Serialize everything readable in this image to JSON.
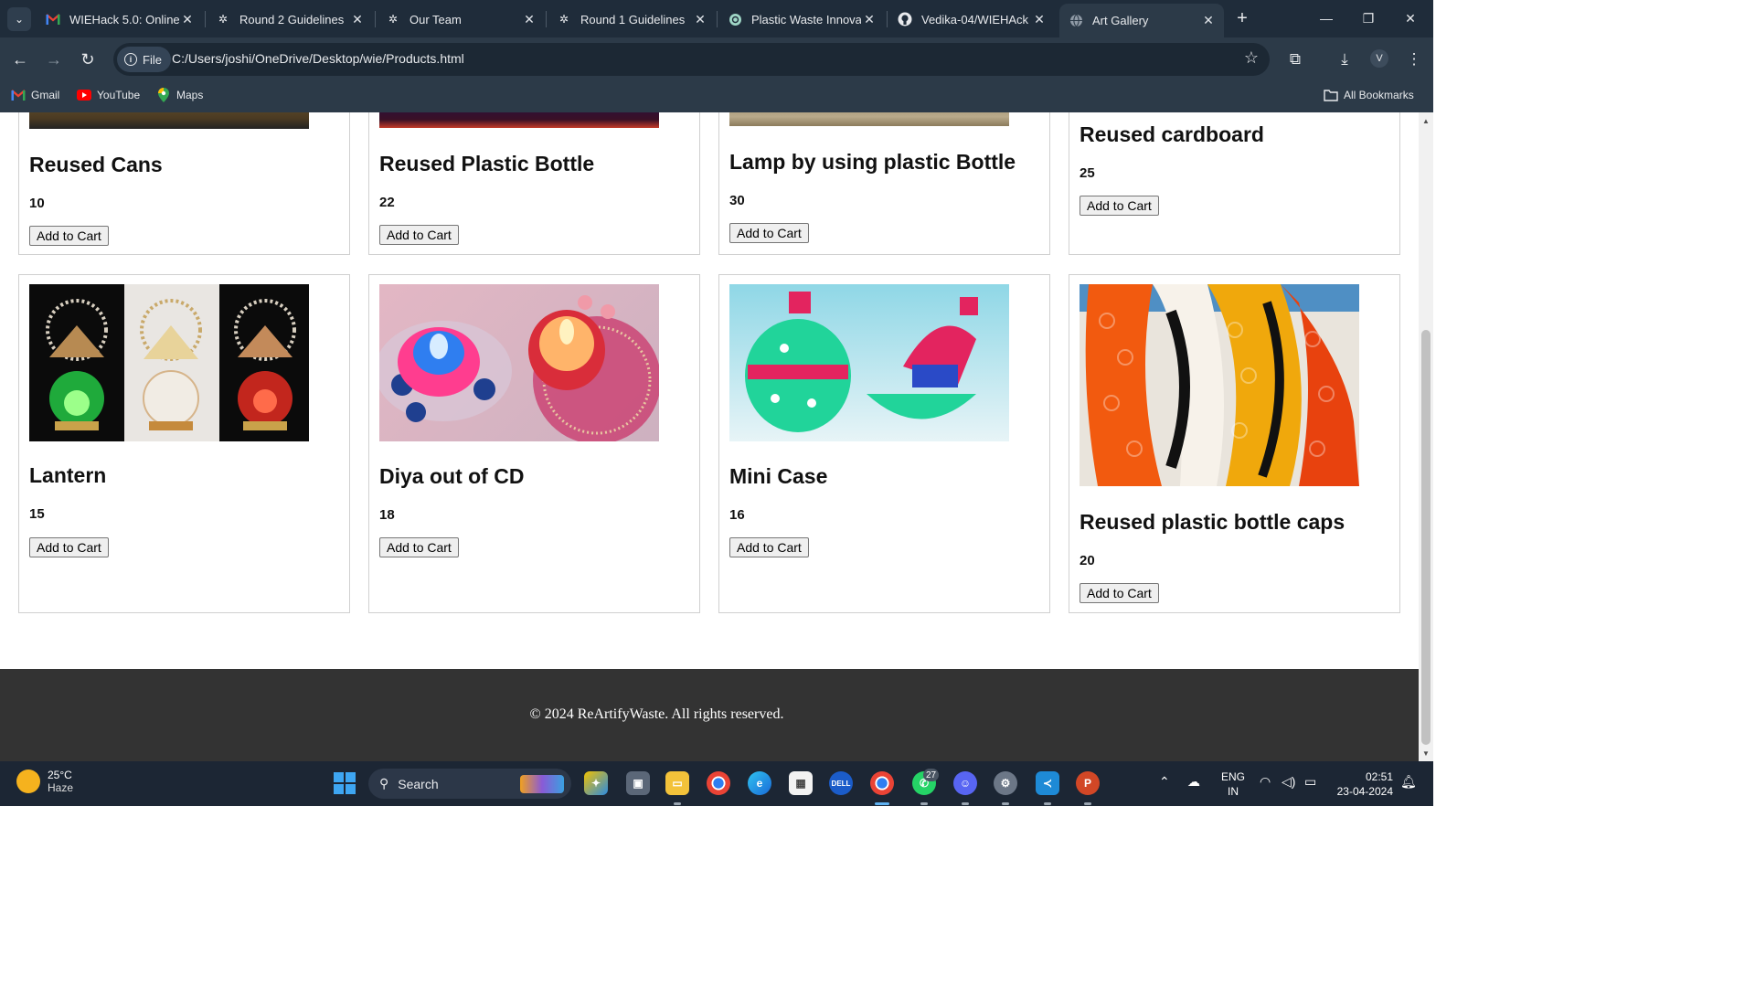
{
  "browser": {
    "tabs": [
      {
        "title": "WIEHack 5.0: Online",
        "icon": "gmail-icon",
        "active": false
      },
      {
        "title": "Round 2 Guidelines",
        "icon": "devfolio-icon",
        "active": false
      },
      {
        "title": "Our Team",
        "icon": "devfolio-icon",
        "active": false
      },
      {
        "title": "Round 1 Guidelines",
        "icon": "devfolio-icon",
        "active": false
      },
      {
        "title": "Plastic Waste Innova",
        "icon": "chatgpt-icon",
        "active": false
      },
      {
        "title": "Vedika-04/WIEHAck",
        "icon": "github-icon",
        "active": false
      },
      {
        "title": "Art Gallery",
        "icon": "globe-icon",
        "active": true
      }
    ],
    "file_chip": "File",
    "url": "C:/Users/joshi/OneDrive/Desktop/wie/Products.html",
    "profile_initial": "V",
    "bookmarks": [
      "Gmail",
      "YouTube",
      "Maps"
    ],
    "all_bookmarks": "All Bookmarks"
  },
  "products": [
    {
      "name": "Reused Cans",
      "price": "10",
      "button": "Add to Cart"
    },
    {
      "name": "Reused Plastic Bottle",
      "price": "22",
      "button": "Add to Cart"
    },
    {
      "name": "Lamp by using plastic Bottle",
      "price": "30",
      "button": "Add to Cart"
    },
    {
      "name": "Reused cardboard",
      "price": "25",
      "button": "Add to Cart"
    },
    {
      "name": "Lantern",
      "price": "15",
      "button": "Add to Cart"
    },
    {
      "name": "Diya out of CD",
      "price": "18",
      "button": "Add to Cart"
    },
    {
      "name": "Mini Case",
      "price": "16",
      "button": "Add to Cart"
    },
    {
      "name": "Reused plastic bottle caps",
      "price": "20",
      "button": "Add to Cart"
    }
  ],
  "footer": {
    "text": "© 2024 ReArtifyWaste. All rights reserved."
  },
  "taskbar": {
    "weather_temp": "25°C",
    "weather_desc": "Haze",
    "search_label": "Search",
    "whatsapp_badge": "27",
    "lang_line1": "ENG",
    "lang_line2": "IN",
    "time": "02:51",
    "date": "23-04-2024"
  },
  "colors": {
    "chrome_dark": "#1f2c3a",
    "chrome": "#2c3a48",
    "footer_bg": "#333333",
    "taskbar_bg": "#1c2634"
  }
}
